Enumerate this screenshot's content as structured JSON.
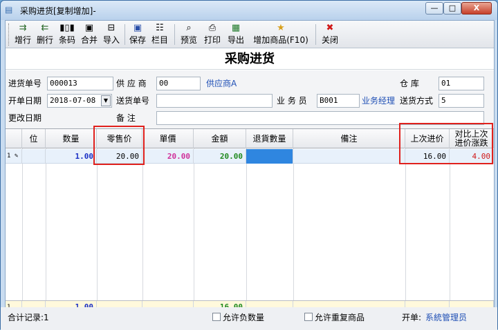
{
  "window": {
    "title": "采购进货[复制增加]-",
    "min_glyph": "—",
    "max_glyph": "□",
    "close_glyph": "X"
  },
  "toolbar": {
    "add_row": "增行",
    "del_row": "删行",
    "barcode": "条码",
    "merge": "合并",
    "import": "导入",
    "save": "保存",
    "columns": "栏目",
    "preview": "预览",
    "print": "打印",
    "export": "导出",
    "add_goods": "增加商品(F10)",
    "close": "关闭"
  },
  "page_title": "采购进货",
  "form": {
    "order_no_label": "进货单号",
    "order_no_value": "000013",
    "supplier_label": "供 应 商",
    "supplier_value": "00",
    "supplier_name": "供应商A",
    "warehouse_label": "仓    库",
    "warehouse_value": "01",
    "date_label": "开单日期",
    "date_value": "2018-07-08",
    "delivery_no_label": "送货单号",
    "delivery_no_value": "",
    "salesman_label": "业 务 员",
    "salesman_value": "B001",
    "salesman_name": "业务经理",
    "delivery_method_label": "送货方式",
    "delivery_method_value": "5",
    "modify_date_label": "更改日期",
    "remark_label": "备    注",
    "remark_value": ""
  },
  "grid": {
    "headers": {
      "pos": "位",
      "qty": "数量",
      "retail": "零售价",
      "unit_price": "單價",
      "amount": "金額",
      "return_qty": "退貨數量",
      "remark": "備注",
      "last_price": "上次进价",
      "compare_line1": "对比上次",
      "compare_line2": "进价涨跌"
    },
    "row": {
      "num": "1",
      "qty": "1.00",
      "retail": "20.00",
      "unit_price": "20.00",
      "amount": "20.00",
      "last_price": "16.00",
      "compare": "4.00"
    },
    "summary": {
      "num": "1",
      "qty": "1.00",
      "amount": "16.00"
    }
  },
  "status": {
    "records_label": "合计记录:1",
    "allow_negative": "允许负数量",
    "allow_dup": "允许重复商品",
    "creator_label": "开单:",
    "creator_value": "系統管理员"
  },
  "colors": {
    "qty": "#1a2fc4",
    "unit_price": "#d0309a",
    "amount": "#1f8a1f",
    "compare": "#d01818",
    "highlight": "#e0201c",
    "selected_cell": "#2f86e0"
  }
}
